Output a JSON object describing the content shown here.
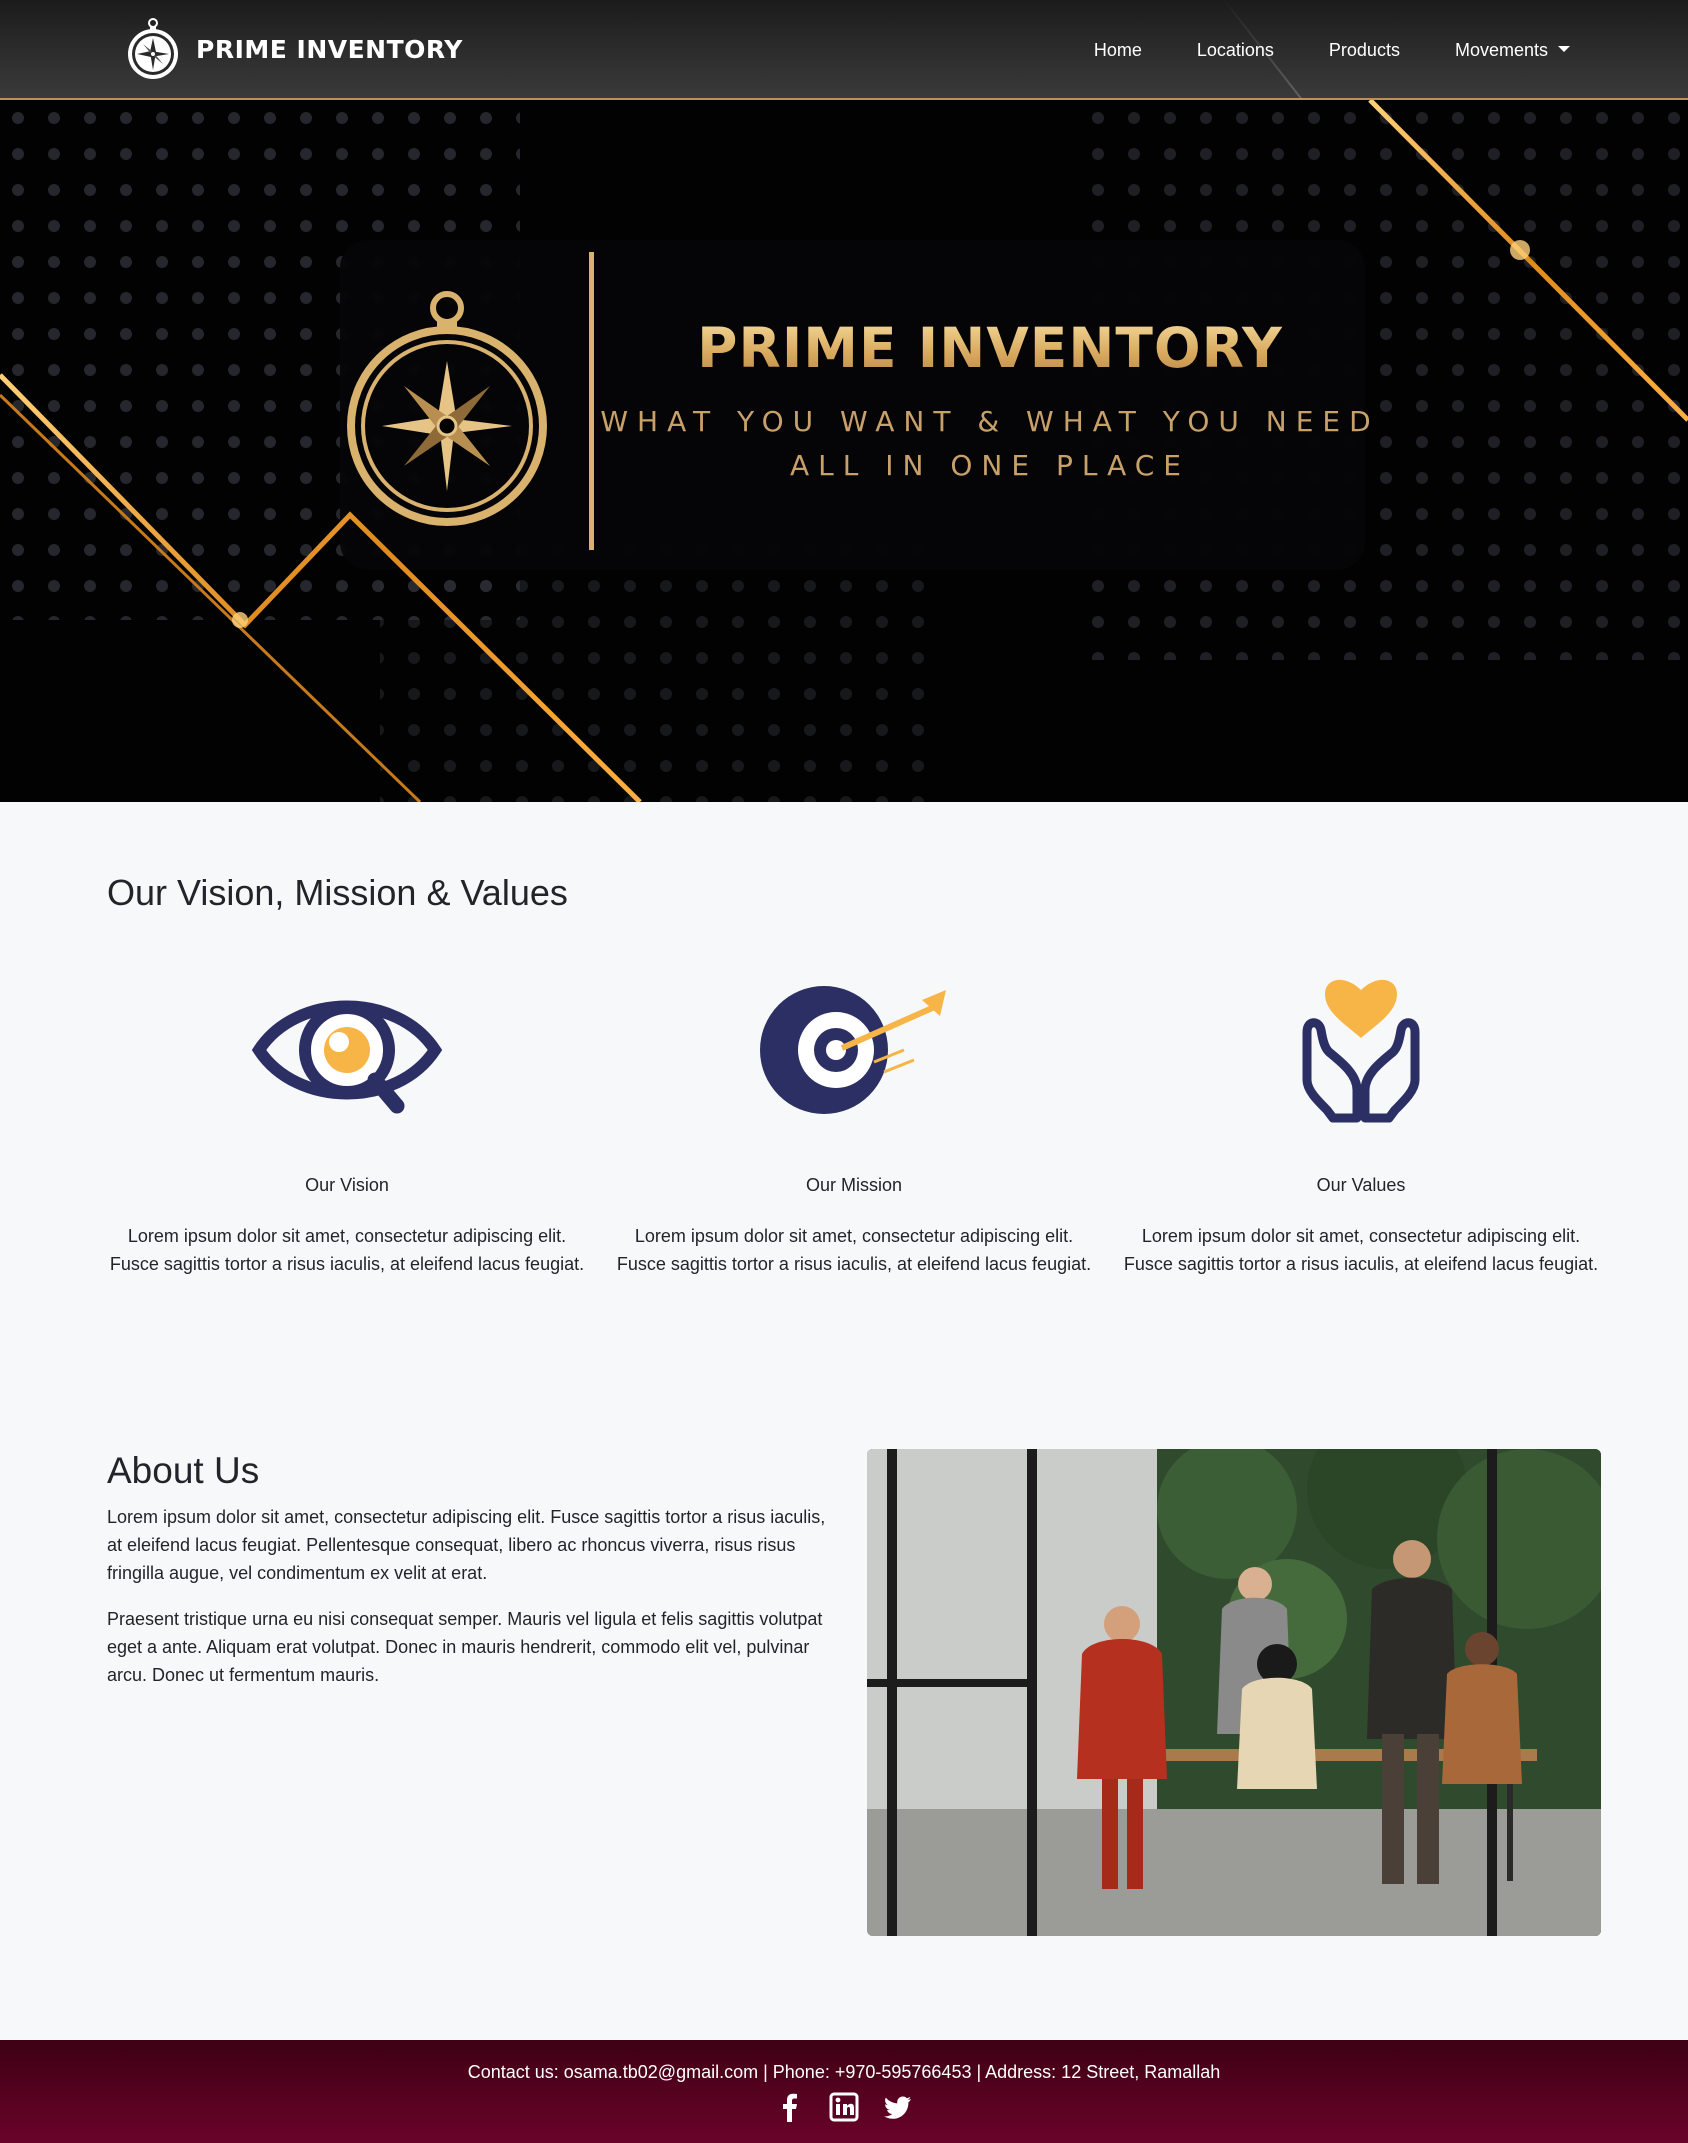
{
  "nav": {
    "brand": "PRIME INVENTORY",
    "links": [
      "Home",
      "Locations",
      "Products",
      "Movements"
    ]
  },
  "hero": {
    "title": "PRIME INVENTORY",
    "subtitle_line1": "WHAT YOU WANT & WHAT YOU NEED",
    "subtitle_line2": "ALL IN ONE PLACE"
  },
  "vmv": {
    "title": "Our Vision, Mission & Values",
    "cards": [
      {
        "icon": "eye-icon",
        "name": "Our Vision",
        "text": "Lorem ipsum dolor sit amet, consectetur adipiscing elit. Fusce sagittis tortor a risus iaculis, at eleifend lacus feugiat."
      },
      {
        "icon": "target-icon",
        "name": "Our Mission",
        "text": "Lorem ipsum dolor sit amet, consectetur adipiscing elit. Fusce sagittis tortor a risus iaculis, at eleifend lacus feugiat."
      },
      {
        "icon": "heart-hands-icon",
        "name": "Our Values",
        "text": "Lorem ipsum dolor sit amet, consectetur adipiscing elit. Fusce sagittis tortor a risus iaculis, at eleifend lacus feugiat."
      }
    ]
  },
  "about": {
    "title": "About Us",
    "p1": "Lorem ipsum dolor sit amet, consectetur adipiscing elit. Fusce sagittis tortor a risus iaculis, at eleifend lacus feugiat. Pellentesque consequat, libero ac rhoncus viverra, risus risus fringilla augue, vel condimentum ex velit at erat.",
    "p2": "Praesent tristique urna eu nisi consequat semper. Mauris vel ligula et felis sagittis volutpat eget a ante. Aliquam erat volutpat. Donec in mauris hendrerit, commodo elit vel, pulvinar arcu. Donec ut fermentum mauris."
  },
  "footer": {
    "contact": "Contact us: osama.tb02@gmail.com | Phone: +970-595766453 | Address: 12 Street, Ramallah",
    "social": [
      "facebook-icon",
      "linkedin-icon",
      "twitter-icon"
    ]
  },
  "colors": {
    "gold": "#d9b26e",
    "navy": "#2b2f63",
    "orange": "#f7b547",
    "footer": "#6a0329",
    "page_bg": "#f7f8fa"
  }
}
